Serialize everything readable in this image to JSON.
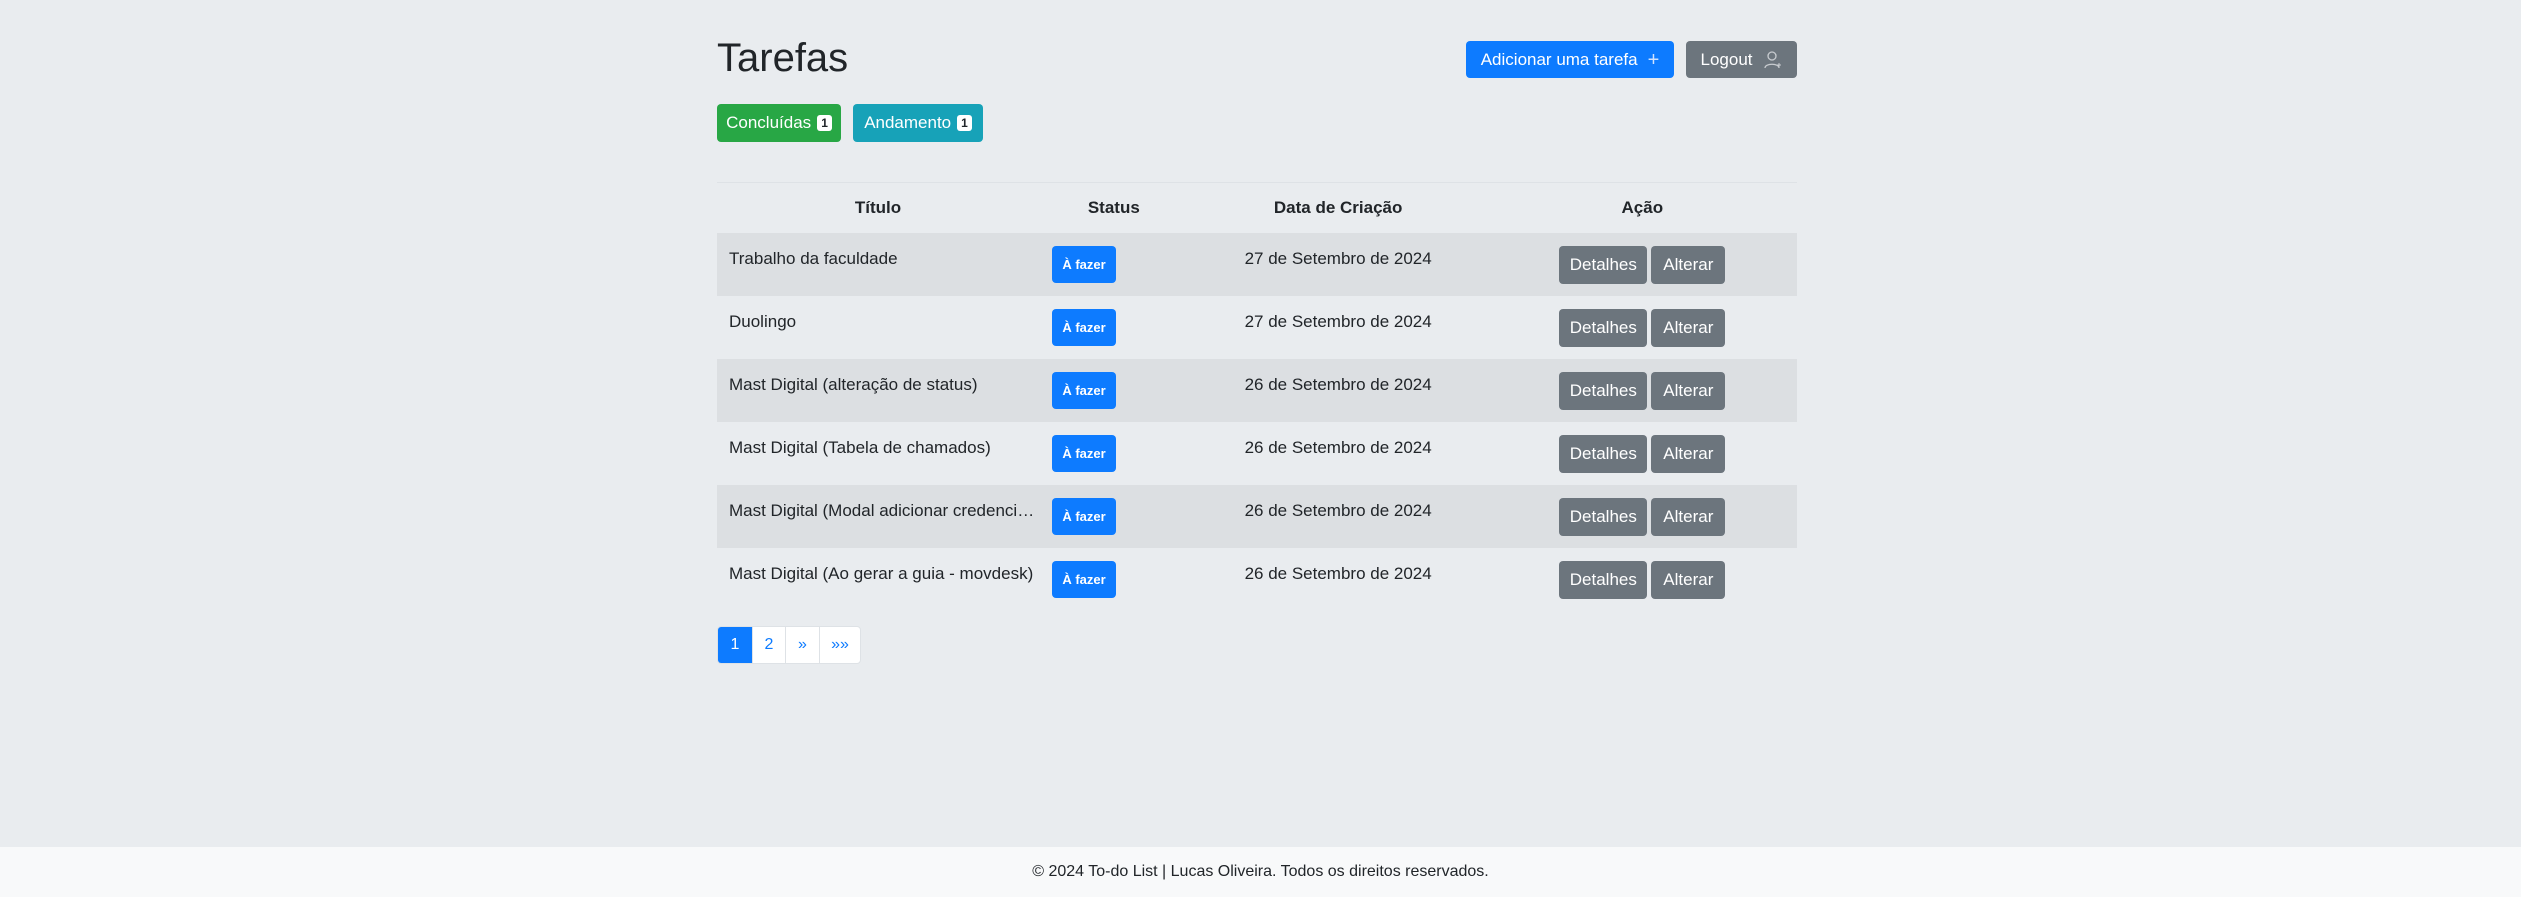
{
  "header": {
    "title": "Tarefas",
    "add_label": "Adicionar uma tarefa",
    "logout_label": "Logout"
  },
  "filters": {
    "concluidas_label": "Concluídas",
    "concluidas_count": "1",
    "andamento_label": "Andamento",
    "andamento_count": "1"
  },
  "table": {
    "headers": [
      "Título",
      "Status",
      "Data de Criação",
      "Ação"
    ],
    "rows": [
      {
        "title": "Trabalho da faculdade",
        "status": "À fazer",
        "date": "27 de Setembro de 2024",
        "details": "Detalhes",
        "edit": "Alterar"
      },
      {
        "title": "Duolingo",
        "status": "À fazer",
        "date": "27 de Setembro de 2024",
        "details": "Detalhes",
        "edit": "Alterar"
      },
      {
        "title": "Mast Digital (alteração de status)",
        "status": "À fazer",
        "date": "26 de Setembro de 2024",
        "details": "Detalhes",
        "edit": "Alterar"
      },
      {
        "title": "Mast Digital (Tabela de chamados)",
        "status": "À fazer",
        "date": "26 de Setembro de 2024",
        "details": "Detalhes",
        "edit": "Alterar"
      },
      {
        "title": "Mast Digital (Modal adicionar credencia...",
        "status": "À fazer",
        "date": "26 de Setembro de 2024",
        "details": "Detalhes",
        "edit": "Alterar"
      },
      {
        "title": "Mast Digital (Ao gerar a guia - movdesk)",
        "status": "À fazer",
        "date": "26 de Setembro de 2024",
        "details": "Detalhes",
        "edit": "Alterar"
      }
    ]
  },
  "pagination": {
    "pages": [
      "1",
      "2",
      "»",
      "»»"
    ],
    "active": "1"
  },
  "footer": {
    "text": "© 2024 To-do List | Lucas Oliveira. Todos os direitos reservados."
  },
  "colors": {
    "primary": "#0d7bff",
    "success": "#28a745",
    "info": "#17a2b8",
    "secondary": "#6c757d",
    "background": "#e9ecef"
  },
  "icons": {
    "add": "plus-icon",
    "logout": "user-icon"
  }
}
